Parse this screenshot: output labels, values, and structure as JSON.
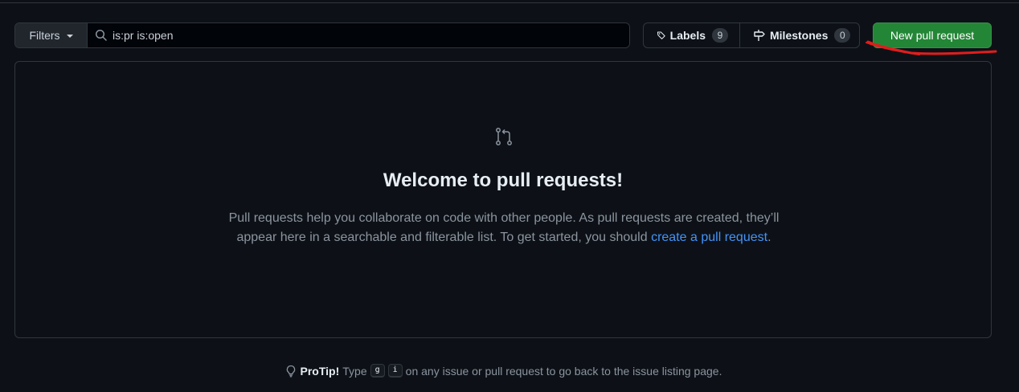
{
  "toolbar": {
    "filters_label": "Filters",
    "search": {
      "value": "is:pr is:open",
      "placeholder": ""
    },
    "labels": {
      "label": "Labels",
      "count": "9"
    },
    "milestones": {
      "label": "Milestones",
      "count": "0"
    },
    "new_pr_label": "New pull request"
  },
  "blankslate": {
    "title": "Welcome to pull requests!",
    "text_before": "Pull requests help you collaborate on code with other people. As pull requests are created, they’ll appear here in a searchable and filterable list. To get started, you should ",
    "link_text": "create a pull request",
    "text_after": "."
  },
  "protip": {
    "label": "ProTip!",
    "before": "Type",
    "key1": "g",
    "key2": "i",
    "after": "on any issue or pull request to go back to the issue listing page."
  },
  "colors": {
    "background": "#0d1117",
    "border": "#30363d",
    "accent_green": "#238636",
    "link_blue": "#4493f8",
    "annotation_red": "#e11d1d"
  },
  "icons": [
    "search-icon",
    "tag-icon",
    "milestone-icon",
    "git-pull-request-icon",
    "light-bulb-icon"
  ]
}
